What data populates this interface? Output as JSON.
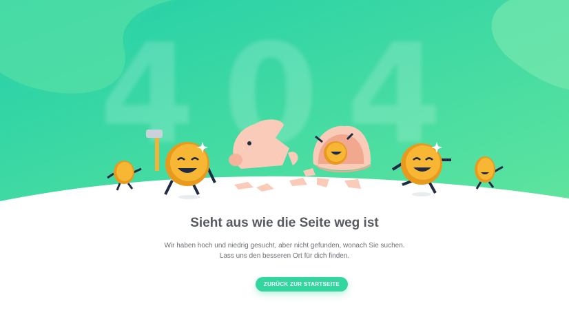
{
  "error_code": "404",
  "heading": "Sieht aus wie die Seite weg ist",
  "description": {
    "line1": "Wir haben hoch und niedrig gesucht, aber nicht gefunden, wonach Sie suchen.",
    "line2": "Lass uns den besseren Ort für dich finden."
  },
  "button": {
    "label": "ZURÜCK ZUR STARTSEITE"
  },
  "colors": {
    "background_gradient_start": "#2ed3a6",
    "background_gradient_end": "#62e6a0",
    "button": "#33d69f",
    "heading": "#555a60",
    "coin": "#f7b633"
  },
  "illustration": {
    "characters": [
      "coin-character",
      "coin-character-with-hammer",
      "broken-piggy-bank",
      "coin-in-eggshell",
      "coin-character",
      "coin-character"
    ]
  }
}
